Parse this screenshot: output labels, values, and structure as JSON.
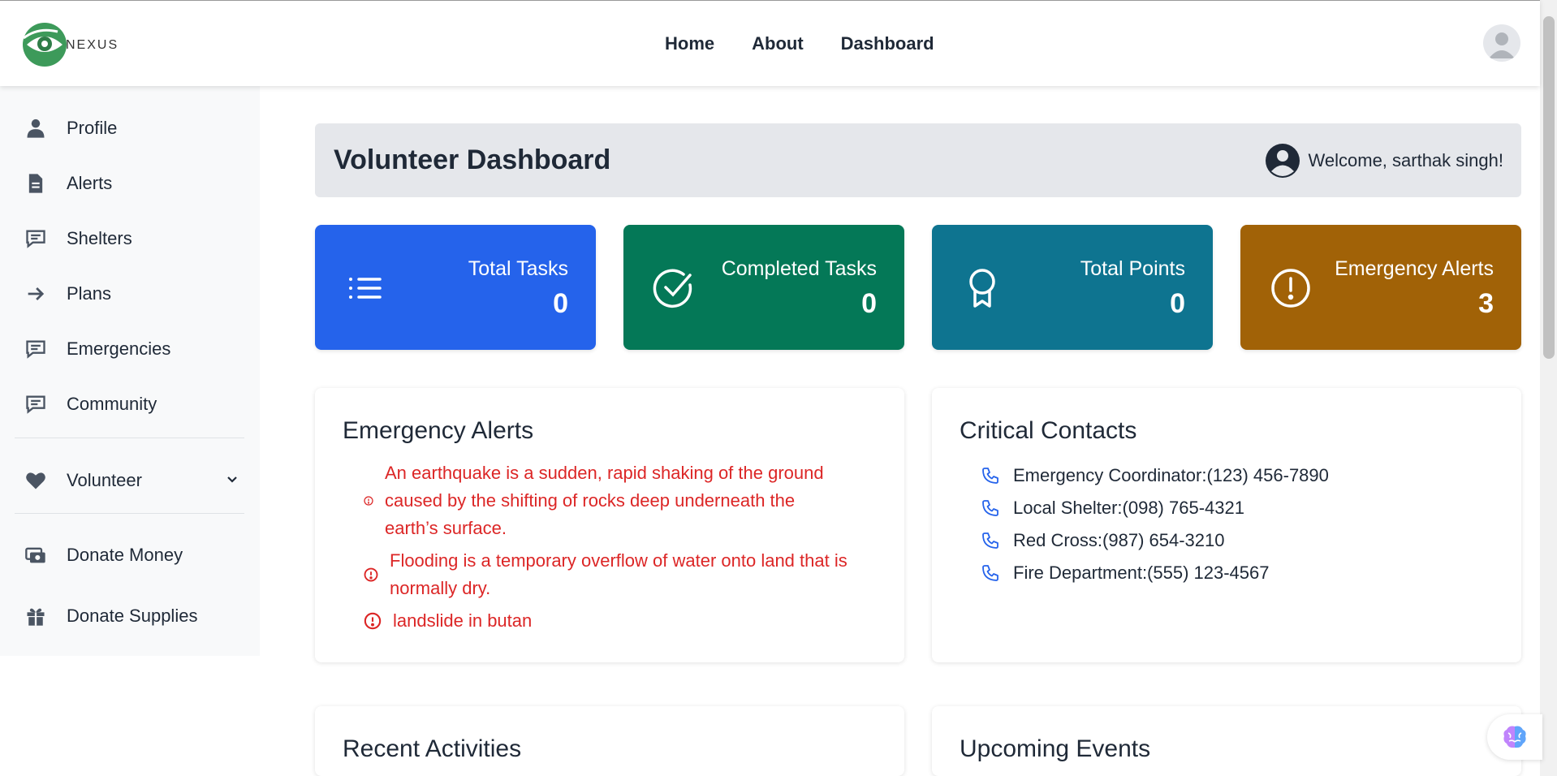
{
  "brand": {
    "name": "NEXUS"
  },
  "nav": {
    "home": "Home",
    "about": "About",
    "dashboard": "Dashboard"
  },
  "sidebar": {
    "items": [
      {
        "label": "Profile",
        "icon": "user-icon"
      },
      {
        "label": "Alerts",
        "icon": "document-icon"
      },
      {
        "label": "Shelters",
        "icon": "chat-icon"
      },
      {
        "label": "Plans",
        "icon": "arrow-right-icon"
      },
      {
        "label": "Emergencies",
        "icon": "chat-icon"
      },
      {
        "label": "Community",
        "icon": "chat-icon"
      }
    ],
    "volunteer": {
      "label": "Volunteer",
      "icon": "heart-icon"
    },
    "donate_money": {
      "label": "Donate Money",
      "icon": "money-icon"
    },
    "donate_supplies": {
      "label": "Donate Supplies",
      "icon": "gift-icon"
    }
  },
  "header": {
    "title": "Volunteer Dashboard",
    "welcome": "Welcome, sarthak singh!"
  },
  "stats": [
    {
      "title": "Total Tasks",
      "value": "0",
      "icon": "list-icon",
      "color": "#2563eb"
    },
    {
      "title": "Completed Tasks",
      "value": "0",
      "icon": "check-circle-icon",
      "color": "#047857"
    },
    {
      "title": "Total Points",
      "value": "0",
      "icon": "award-icon",
      "color": "#0e7490"
    },
    {
      "title": "Emergency Alerts",
      "value": "3",
      "icon": "alert-circle-icon",
      "color": "#a16207"
    }
  ],
  "alerts_card": {
    "title": "Emergency Alerts",
    "items": [
      "An earthquake is a sudden, rapid shaking of the ground caused by the shifting of rocks deep underneath the earth’s surface.",
      "Flooding is a temporary overflow of water onto land that is normally dry.",
      "landslide in butan"
    ]
  },
  "contacts_card": {
    "title": "Critical Contacts",
    "items": [
      "Emergency Coordinator:(123) 456-7890",
      "Local Shelter:(098) 765-4321",
      "Red Cross:(987) 654-3210",
      "Fire Department:(555) 123-4567"
    ]
  },
  "activities_card": {
    "title": "Recent Activities"
  },
  "events_card": {
    "title": "Upcoming Events"
  }
}
